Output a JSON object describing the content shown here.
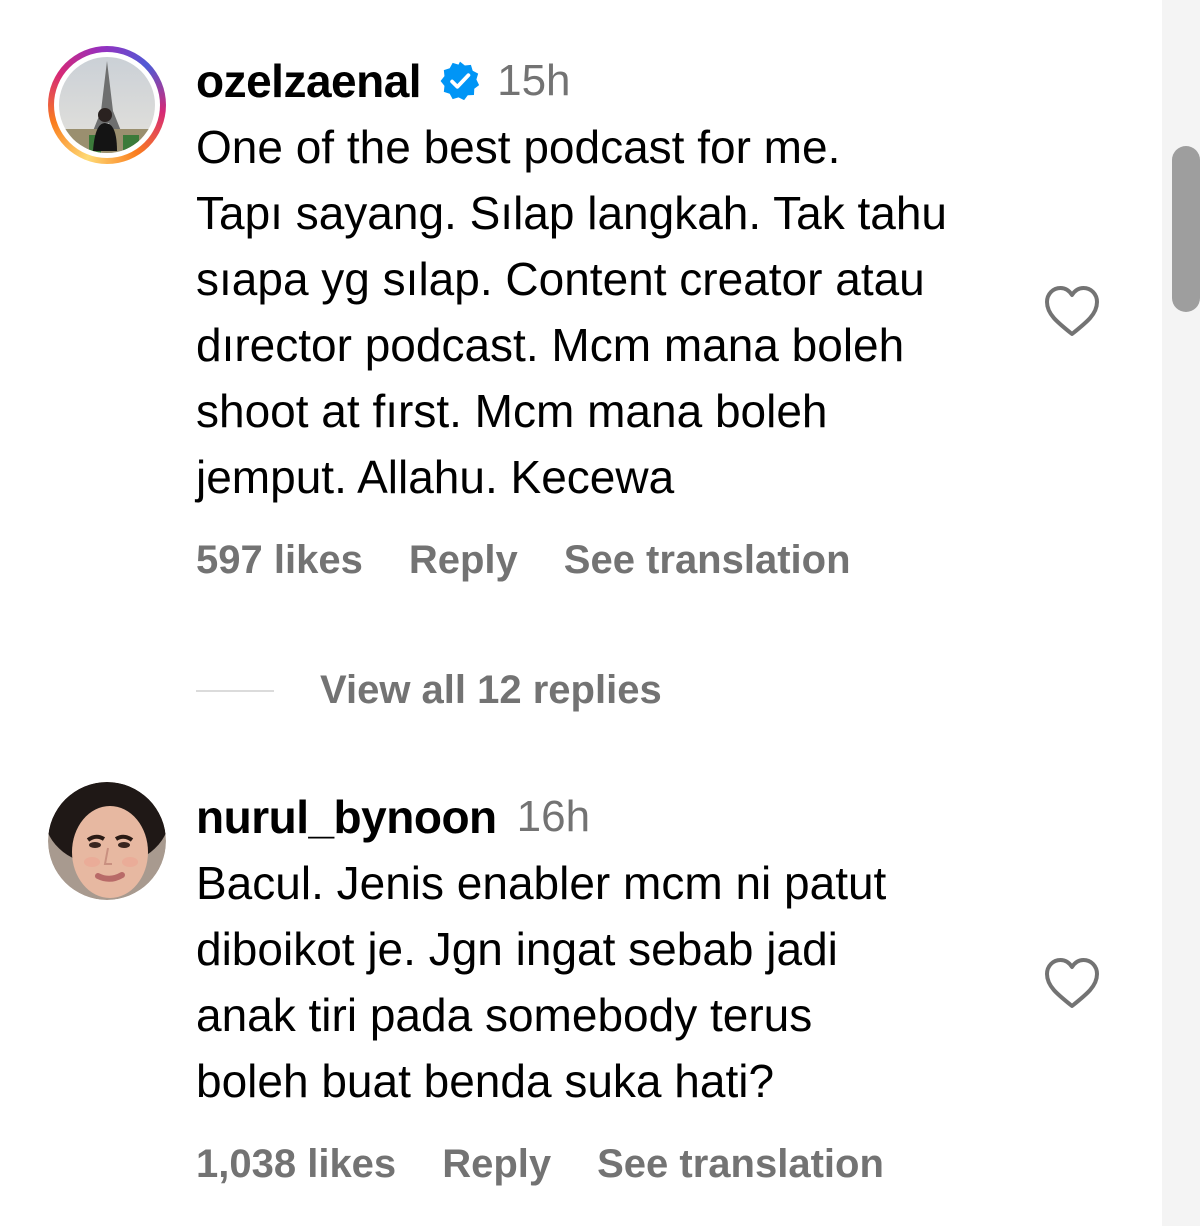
{
  "comments": [
    {
      "username": "ozelzaenal",
      "verified": true,
      "time": "15h",
      "text": "One of the best podcast for me.\nTapı sayang. Sılap langkah. Tak tahu\nsıapa yg sılap. Content creator atau\ndırector podcast. Mcm mana boleh\nshoot at fırst. Mcm mana boleh\njemput. Allahu. Kecewa",
      "likes": "597 likes",
      "reply_label": "Reply",
      "translate_label": "See translation",
      "view_replies": "View all 12 replies"
    },
    {
      "username": "nurul_bynoon",
      "verified": false,
      "time": "16h",
      "text": "Bacul. Jenis enabler mcm ni patut\ndiboikot je. Jgn ingat sebab jadi\nanak tiri pada somebody terus\nboleh buat benda suka hati?",
      "likes": "1,038 likes",
      "reply_label": "Reply",
      "translate_label": "See translation"
    }
  ],
  "icons": {
    "verified": "verified-badge-icon",
    "like": "heart-outline-icon"
  },
  "colors": {
    "verified_blue": "#0095f6",
    "muted_text": "#737373"
  }
}
